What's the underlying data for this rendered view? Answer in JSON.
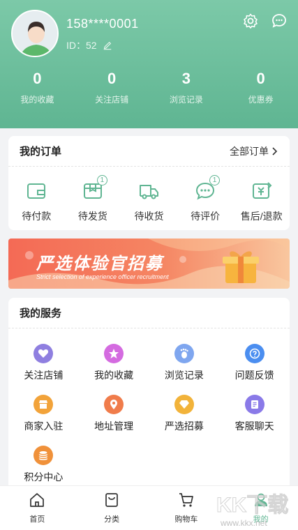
{
  "user": {
    "phone": "158****0001",
    "id_label": "ID：52"
  },
  "stats": [
    {
      "value": "0",
      "label": "我的收藏"
    },
    {
      "value": "0",
      "label": "关注店铺"
    },
    {
      "value": "3",
      "label": "浏览记录"
    },
    {
      "value": "0",
      "label": "优惠券"
    }
  ],
  "orders": {
    "title": "我的订单",
    "all_label": "全部订单",
    "items": [
      {
        "label": "待付款",
        "icon": "wallet-icon",
        "badge": ""
      },
      {
        "label": "待发货",
        "icon": "package-icon",
        "badge": "1"
      },
      {
        "label": "待收货",
        "icon": "truck-icon",
        "badge": ""
      },
      {
        "label": "待评价",
        "icon": "comment-icon",
        "badge": "1"
      },
      {
        "label": "售后/退款",
        "icon": "refund-icon",
        "badge": ""
      }
    ]
  },
  "banner": {
    "title": "严选体验官招募",
    "subtitle": "Strict selection of experience officer recruitment"
  },
  "services": {
    "title": "我的服务",
    "items": [
      {
        "label": "关注店铺",
        "icon": "heart-icon",
        "color": "#8f7fe0"
      },
      {
        "label": "我的收藏",
        "icon": "star-icon",
        "color": "#d46be0"
      },
      {
        "label": "浏览记录",
        "icon": "footprint-icon",
        "color": "#7fa6ef"
      },
      {
        "label": "问题反馈",
        "icon": "question-icon",
        "color": "#4b8ef0"
      },
      {
        "label": "商家入驻",
        "icon": "shop-icon",
        "color": "#f2a33a"
      },
      {
        "label": "地址管理",
        "icon": "location-icon",
        "color": "#f07c4b"
      },
      {
        "label": "严选招募",
        "icon": "diamond-icon",
        "color": "#f2b33a"
      },
      {
        "label": "客服聊天",
        "icon": "chat-icon",
        "color": "#8a7ae8"
      },
      {
        "label": "积分中心",
        "icon": "coins-icon",
        "color": "#f0913a"
      }
    ]
  },
  "tabs": [
    {
      "label": "首页",
      "icon": "home-icon"
    },
    {
      "label": "分类",
      "icon": "bag-icon"
    },
    {
      "label": "购物车",
      "icon": "cart-icon"
    },
    {
      "label": "我的",
      "icon": "profile-icon",
      "active": true
    }
  ],
  "colors": {
    "accent": "#5fb592",
    "header": "#7cc9a8"
  },
  "watermark": "KK下载 www.kkx.net"
}
